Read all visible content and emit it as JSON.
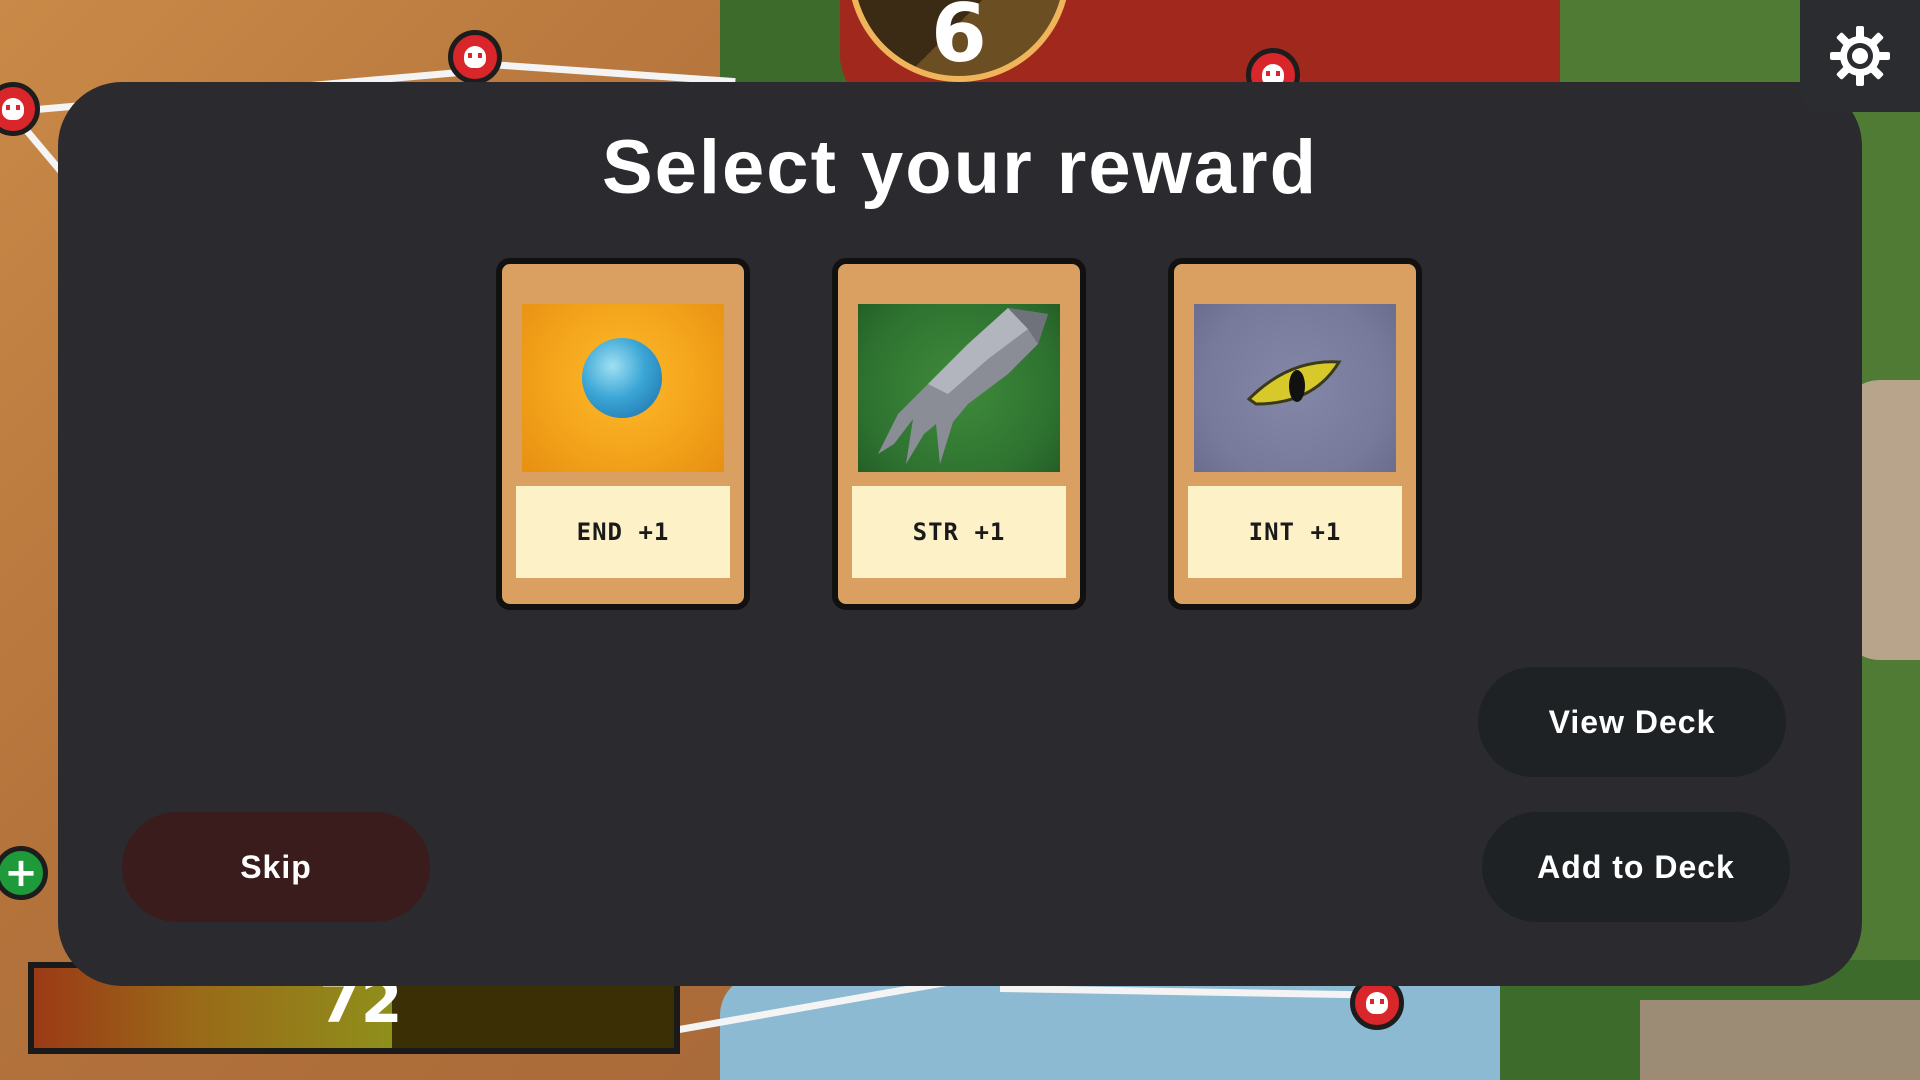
{
  "hud": {
    "turn_value": "6",
    "settings_icon": "gear-icon"
  },
  "health": {
    "value": "72",
    "fill_fraction": 0.56
  },
  "modal": {
    "title": "Select your reward",
    "cards": [
      {
        "label": "END +1",
        "art": "blue-orb"
      },
      {
        "label": "STR +1",
        "art": "metal-claw"
      },
      {
        "label": "INT +1",
        "art": "yellow-eye"
      }
    ],
    "buttons": {
      "view_deck": "View Deck",
      "add_to_deck": "Add to Deck",
      "skip": "Skip"
    }
  },
  "colors": {
    "modal_bg": "#2b2b2f",
    "card_frame": "#d9a062",
    "card_label_bg": "#fdf1c7",
    "skip_button": "#3a1c1c",
    "action_button": "#1e2224"
  }
}
